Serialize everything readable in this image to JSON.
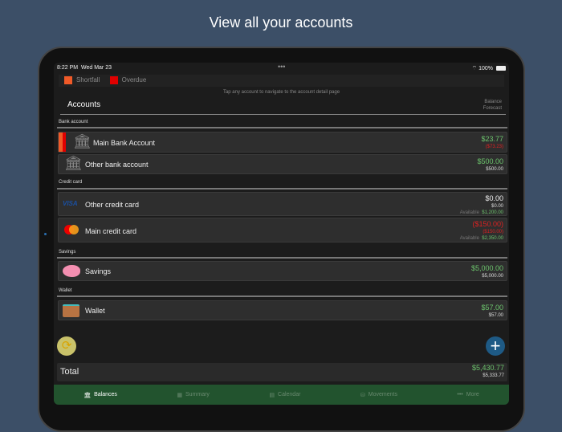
{
  "headline": "View all your accounts",
  "status": {
    "time": "8:22 PM",
    "date": "Wed Mar 23",
    "battery": "100%"
  },
  "legend": {
    "shortfall": "Shortfall",
    "overdue": "Overdue",
    "shortfall_color": "#f05a28",
    "overdue_color": "#e00000"
  },
  "hint": "Tap any account to navigate to the account detail page",
  "accounts_title": "Accounts",
  "col_header": {
    "line1": "Balance",
    "line2": "Forecast"
  },
  "sections": [
    {
      "title": "Bank account"
    },
    {
      "title": "Credit card"
    },
    {
      "title": "Savings"
    },
    {
      "title": "Wallet"
    }
  ],
  "accounts": [
    {
      "name": "Main Bank Account",
      "balance": "$23.77",
      "forecast": "($73.23)"
    },
    {
      "name": "Other bank account",
      "balance": "$500.00",
      "forecast": "$500.00"
    },
    {
      "name": "Other credit card",
      "balance": "$0.00",
      "forecast": "$0.00",
      "available_label": "Available",
      "available": "$1,200.00",
      "logo": "VISA"
    },
    {
      "name": "Main credit card",
      "balance": "($150.00)",
      "forecast": "($150.00)",
      "available_label": "Available",
      "available": "$2,350.00"
    },
    {
      "name": "Savings",
      "balance": "$5,000.00",
      "forecast": "$5,000.00"
    },
    {
      "name": "Wallet",
      "balance": "$57.00",
      "forecast": "$57.00"
    }
  ],
  "total": {
    "label": "Total",
    "balance": "$5,430.77",
    "forecast": "$5,333.77"
  },
  "tabs": [
    {
      "label": "Balances"
    },
    {
      "label": "Summary"
    },
    {
      "label": "Calendar"
    },
    {
      "label": "Movements"
    },
    {
      "label": "More"
    }
  ]
}
